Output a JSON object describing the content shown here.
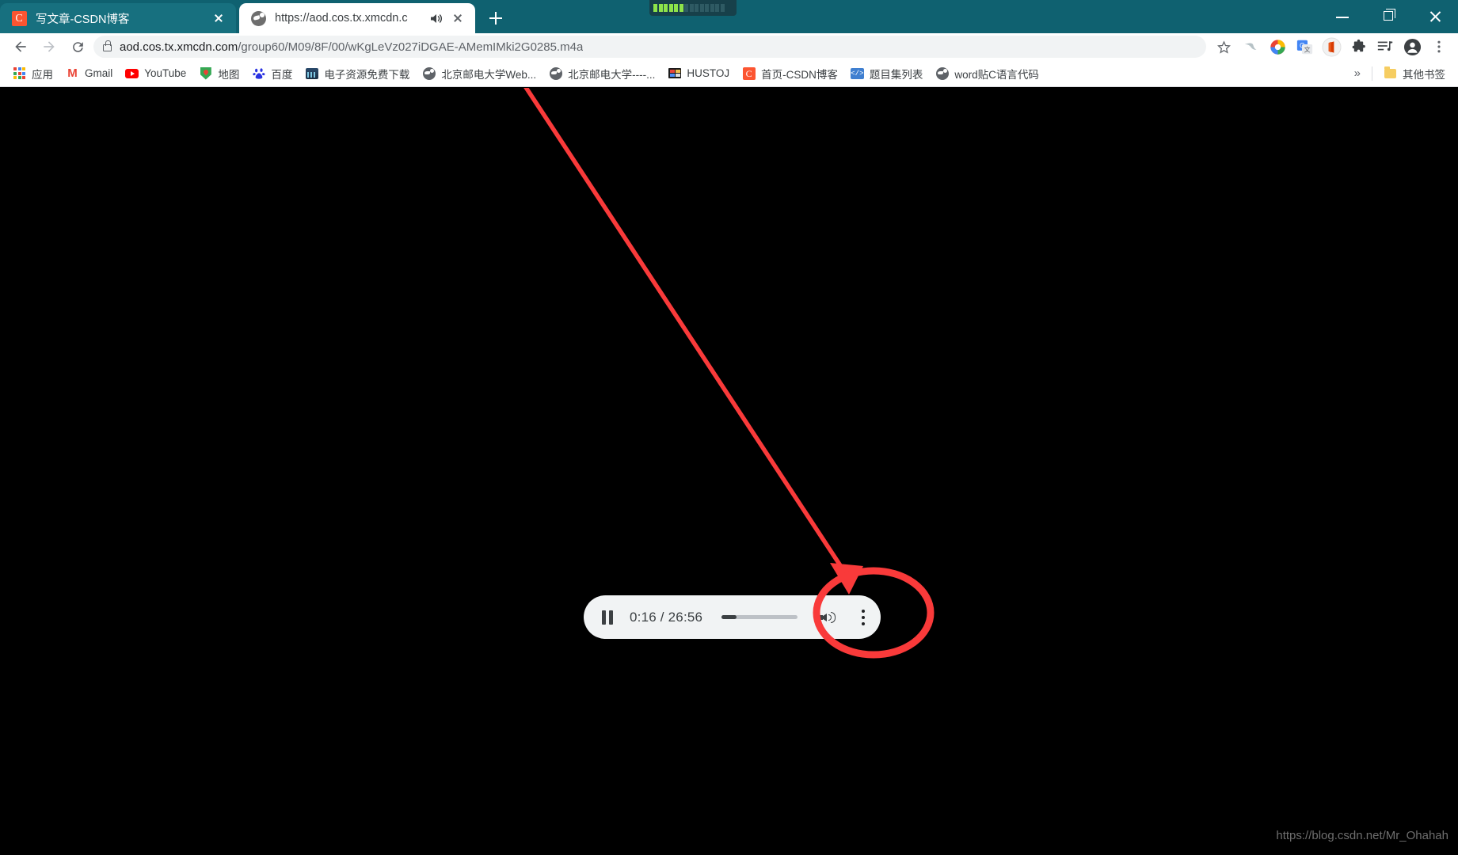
{
  "window": {
    "theme_color": "#0f6170",
    "controls": {
      "minimize": "minimize",
      "maximize": "maximize",
      "close": "close"
    },
    "gadget": {
      "name": "cpu-meter-gadget",
      "segments_total": 14,
      "segments_on": 6
    }
  },
  "tabs": [
    {
      "title": "写文章-CSDN博客",
      "favicon": "csdn-favicon",
      "favicon_letter": "C",
      "active": false,
      "audio_playing": false,
      "close_label": "close-tab"
    },
    {
      "title": "https://aod.cos.tx.xmcdn.c",
      "favicon": "globe-favicon",
      "active": true,
      "audio_playing": true,
      "audio_icon": "speaker-icon",
      "close_label": "close-tab"
    }
  ],
  "new_tab_label": "new-tab",
  "toolbar": {
    "back": "back-arrow-icon",
    "forward": "forward-arrow-icon",
    "reload": "reload-icon",
    "lock": "lock-icon",
    "url_domain": "aod.cos.tx.xmcdn.com",
    "url_path": "/group60/M09/8F/00/wKgLeVz027iDGAE-AMemIMki2G0285.m4a",
    "star": "bookmark-star-icon",
    "icons": [
      {
        "name": "bird-extension-icon",
        "glyph": "bird"
      },
      {
        "name": "chrome-circle-icon",
        "glyph": "circle"
      },
      {
        "name": "google-translate-icon",
        "glyph": "G"
      },
      {
        "name": "office-icon",
        "glyph": "office"
      },
      {
        "name": "extensions-puzzle-icon",
        "glyph": "puzzle"
      },
      {
        "name": "media-playlist-icon",
        "glyph": "playlist"
      },
      {
        "name": "profile-avatar-icon",
        "glyph": "avatar"
      },
      {
        "name": "chrome-menu-icon",
        "glyph": "kebab"
      }
    ]
  },
  "bookmarks": {
    "items": [
      {
        "label": "应用",
        "icon": "apps-grid-icon"
      },
      {
        "label": "Gmail",
        "icon": "gmail-icon"
      },
      {
        "label": "YouTube",
        "icon": "youtube-icon"
      },
      {
        "label": "地图",
        "icon": "google-maps-icon"
      },
      {
        "label": "百度",
        "icon": "baidu-icon"
      },
      {
        "label": "电子资源免费下载",
        "icon": "chart-icon"
      },
      {
        "label": "北京邮电大学Web...",
        "icon": "globe-icon"
      },
      {
        "label": "北京邮电大学----...",
        "icon": "globe-icon"
      },
      {
        "label": "HUSTOJ",
        "icon": "hustoj-icon"
      },
      {
        "label": "首页-CSDN博客",
        "icon": "csdn-icon"
      },
      {
        "label": "题目集列表",
        "icon": "code-icon"
      },
      {
        "label": "word贴C语言代码",
        "icon": "globe-icon"
      }
    ],
    "overflow_label": "»",
    "other_bookmarks": {
      "label": "其他书签",
      "icon": "folder-icon"
    }
  },
  "page": {
    "background": "#000000",
    "audio_player": {
      "play_state": "pause-icon",
      "current_time": "0:16",
      "separator": "/",
      "duration": "26:56",
      "time_display": "0:16 / 26:56",
      "progress_percent": 20,
      "volume_icon": "volume-high-icon",
      "more_options": "more-options-kebab-icon"
    },
    "annotation": {
      "color": "#f93a3a",
      "type": "arrow-and-ellipse-highlight",
      "target": "more-options-kebab-icon"
    },
    "watermark": "https://blog.csdn.net/Mr_Ohahah"
  }
}
